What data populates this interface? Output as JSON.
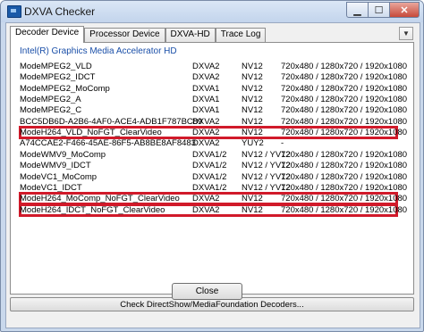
{
  "window": {
    "title": "DXVA Checker",
    "close_glyph": "✕",
    "min_glyph": "▁",
    "max_glyph": "☐"
  },
  "tabs": [
    {
      "label": "Decoder Device",
      "active": true
    },
    {
      "label": "Processor Device",
      "active": false
    },
    {
      "label": "DXVA-HD",
      "active": false
    },
    {
      "label": "Trace Log",
      "active": false
    }
  ],
  "tab_dropdown_glyph": "▼",
  "device": {
    "name": "Intel(R) Graphics Media Accelerator HD"
  },
  "rows": [
    {
      "mode": "ModeMPEG2_VLD",
      "api": "DXVA2",
      "format": "NV12",
      "res": "720x480 / 1280x720 / 1920x1080",
      "highlighted": false
    },
    {
      "mode": "ModeMPEG2_IDCT",
      "api": "DXVA2",
      "format": "NV12",
      "res": "720x480 / 1280x720 / 1920x1080",
      "highlighted": false
    },
    {
      "mode": "ModeMPEG2_MoComp",
      "api": "DXVA1",
      "format": "NV12",
      "res": "720x480 / 1280x720 / 1920x1080",
      "highlighted": false
    },
    {
      "mode": "ModeMPEG2_A",
      "api": "DXVA1",
      "format": "NV12",
      "res": "720x480 / 1280x720 / 1920x1080",
      "highlighted": false
    },
    {
      "mode": "ModeMPEG2_C",
      "api": "DXVA1",
      "format": "NV12",
      "res": "720x480 / 1280x720 / 1920x1080",
      "highlighted": false
    },
    {
      "mode": "BCC5DB6D-A2B6-4AF0-ACE4-ADB1F787BC89",
      "api": "DXVA2",
      "format": "NV12",
      "res": "720x480 / 1280x720 / 1920x1080",
      "highlighted": false
    },
    {
      "mode": "ModeH264_VLD_NoFGT_ClearVideo",
      "api": "DXVA2",
      "format": "NV12",
      "res": "720x480 / 1280x720 / 1920x1080",
      "highlighted": true
    },
    {
      "mode": "A74CCAE2-F466-45AE-86F5-AB8BE8AF8483",
      "api": "DXVA2",
      "format": "YUY2",
      "res": "-",
      "highlighted": false
    },
    {
      "mode": "ModeWMV9_MoComp",
      "api": "DXVA1/2",
      "format": "NV12 / YV12",
      "res": "720x480 / 1280x720 / 1920x1080",
      "highlighted": false
    },
    {
      "mode": "ModeWMV9_IDCT",
      "api": "DXVA1/2",
      "format": "NV12 / YV12",
      "res": "720x480 / 1280x720 / 1920x1080",
      "highlighted": false
    },
    {
      "mode": "ModeVC1_MoComp",
      "api": "DXVA1/2",
      "format": "NV12 / YV12",
      "res": "720x480 / 1280x720 / 1920x1080",
      "highlighted": false
    },
    {
      "mode": "ModeVC1_IDCT",
      "api": "DXVA1/2",
      "format": "NV12 / YV12",
      "res": "720x480 / 1280x720 / 1920x1080",
      "highlighted": false
    },
    {
      "mode": "ModeH264_MoComp_NoFGT_ClearVideo",
      "api": "DXVA2",
      "format": "NV12",
      "res": "720x480 / 1280x720 / 1920x1080",
      "highlighted": true
    },
    {
      "mode": "ModeH264_IDCT_NoFGT_ClearVideo",
      "api": "DXVA2",
      "format": "NV12",
      "res": "720x480 / 1280x720 / 1920x1080",
      "highlighted": true
    }
  ],
  "highlight_color": "#d11a2a",
  "check_button": {
    "label": "Check DirectShow/MediaFoundation Decoders..."
  },
  "close_button": {
    "label": "Close"
  }
}
